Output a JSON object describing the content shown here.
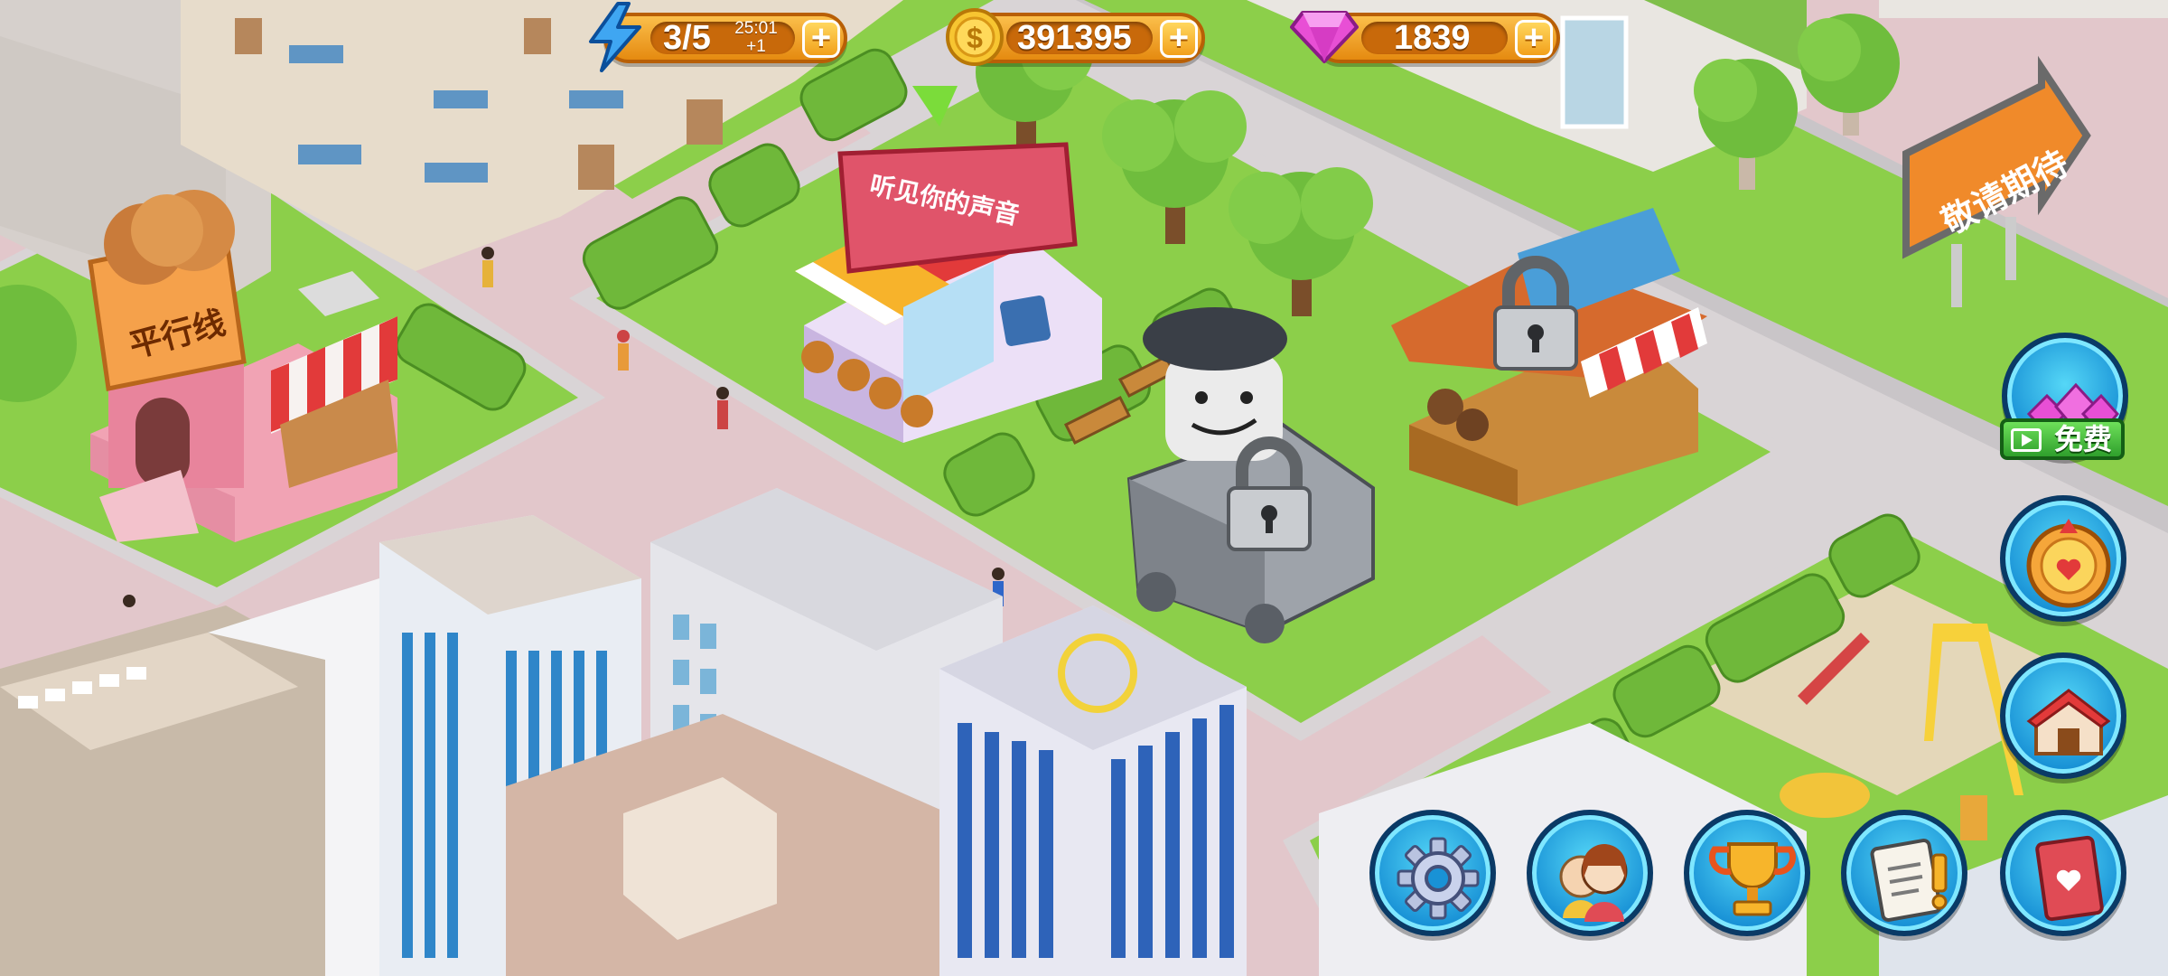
{
  "hud": {
    "energy": {
      "value": "3/5",
      "timer": "25:01",
      "timer_bonus": "+1",
      "plus": "+",
      "icon": "lightning-icon"
    },
    "coins": {
      "value": "391395",
      "plus": "+",
      "icon": "coin-icon"
    },
    "gems": {
      "value": "1839",
      "plus": "+",
      "icon": "gem-icon"
    }
  },
  "buildings": {
    "bakery_sign": "平行线",
    "music_shop_sign": "听见你的声音",
    "coming_soon_sign": "敬请期待"
  },
  "side_buttons": {
    "free_gems": {
      "label": "免费",
      "icon": "video-ad-icon"
    },
    "spin_wheel": {
      "icon": "spin-wheel-icon"
    },
    "shop": {
      "icon": "shop-icon"
    }
  },
  "bottom_buttons": [
    {
      "icon": "settings-gear-icon"
    },
    {
      "icon": "friends-icon"
    },
    {
      "icon": "trophy-icon"
    },
    {
      "icon": "tasks-clipboard-icon"
    },
    {
      "icon": "recipe-book-icon"
    }
  ],
  "colors": {
    "hud_orange": "#f2a01b",
    "button_blue": "#1992d6",
    "grass": "#8ccf4a",
    "road": "#e2c7cb",
    "free_green": "#2f9f2c"
  }
}
